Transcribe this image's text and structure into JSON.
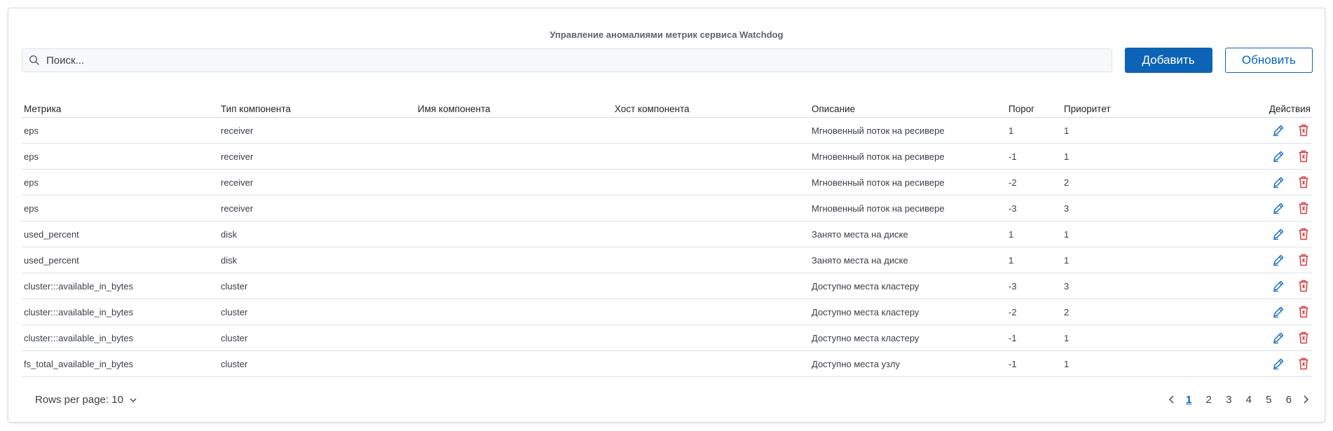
{
  "title": "Управление аномалиями метрик сервиса Watchdog",
  "search": {
    "placeholder": "Поиск..."
  },
  "buttons": {
    "add": "Добавить",
    "refresh": "Обновить"
  },
  "columns": [
    "Метрика",
    "Тип компонента",
    "Имя компонента",
    "Хост компонента",
    "Описание",
    "Порог",
    "Приоритет",
    "Действия"
  ],
  "rows": [
    {
      "metric": "eps",
      "type": "receiver",
      "name": "",
      "host": "",
      "description": "Мгновенный поток на ресивере",
      "threshold": "1",
      "priority": "1"
    },
    {
      "metric": "eps",
      "type": "receiver",
      "name": "",
      "host": "",
      "description": "Мгновенный поток на ресивере",
      "threshold": "-1",
      "priority": "1"
    },
    {
      "metric": "eps",
      "type": "receiver",
      "name": "",
      "host": "",
      "description": "Мгновенный поток на ресивере",
      "threshold": "-2",
      "priority": "2"
    },
    {
      "metric": "eps",
      "type": "receiver",
      "name": "",
      "host": "",
      "description": "Мгновенный поток на ресивере",
      "threshold": "-3",
      "priority": "3"
    },
    {
      "metric": "used_percent",
      "type": "disk",
      "name": "",
      "host": "",
      "description": "Занято места на диске",
      "threshold": "1",
      "priority": "1"
    },
    {
      "metric": "used_percent",
      "type": "disk",
      "name": "",
      "host": "",
      "description": "Занято места на диске",
      "threshold": "1",
      "priority": "1"
    },
    {
      "metric": "cluster:::available_in_bytes",
      "type": "cluster",
      "name": "",
      "host": "",
      "description": "Доступно места кластеру",
      "threshold": "-3",
      "priority": "3"
    },
    {
      "metric": "cluster:::available_in_bytes",
      "type": "cluster",
      "name": "",
      "host": "",
      "description": "Доступно места кластеру",
      "threshold": "-2",
      "priority": "2"
    },
    {
      "metric": "cluster:::available_in_bytes",
      "type": "cluster",
      "name": "",
      "host": "",
      "description": "Доступно места кластеру",
      "threshold": "-1",
      "priority": "1"
    },
    {
      "metric": "fs_total_available_in_bytes",
      "type": "cluster",
      "name": "",
      "host": "",
      "description": "Доступно места узлу",
      "threshold": "-1",
      "priority": "1"
    }
  ],
  "icons": {
    "edit": "pencil-icon",
    "delete": "trash-icon",
    "search": "search-icon",
    "dropdown": "chevron-down-icon",
    "prev": "chevron-left-icon",
    "next": "chevron-right-icon"
  },
  "colors": {
    "primary": "#0d63b5",
    "edit": "#1a6fc4",
    "delete": "#d93a3a"
  },
  "pagination": {
    "rows_per_page": "Rows per page: 10",
    "pages": [
      "1",
      "2",
      "3",
      "4",
      "5",
      "6"
    ],
    "current": "1"
  }
}
